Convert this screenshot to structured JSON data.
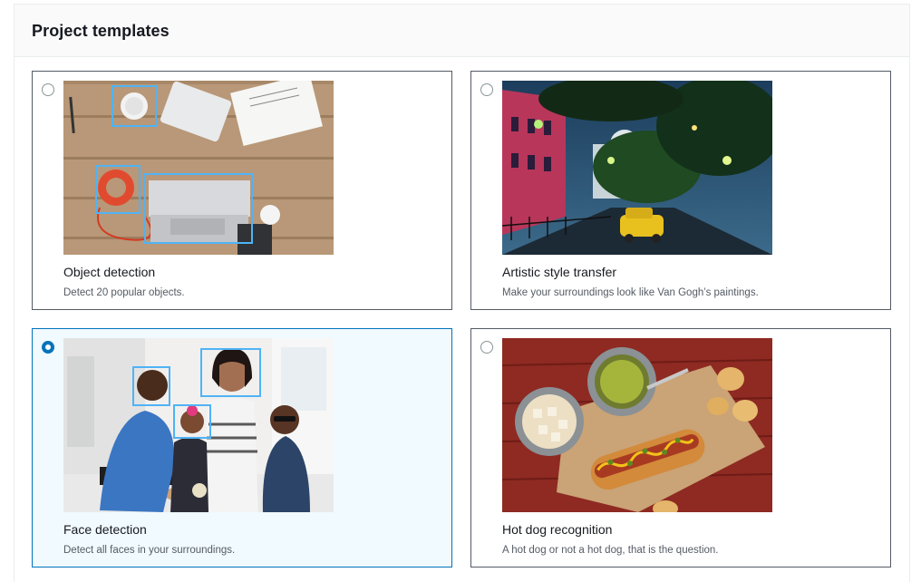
{
  "panel": {
    "title": "Project templates"
  },
  "templates": [
    {
      "title": "Object detection",
      "description": "Detect 20 popular objects.",
      "selected": false,
      "image": "desk-with-laptop-coffee-headphones-notebook"
    },
    {
      "title": "Artistic style transfer",
      "description": "Make your surroundings look like Van Gogh’s paintings.",
      "selected": false,
      "image": "painted-night-street-with-taxi"
    },
    {
      "title": "Face detection",
      "description": "Detect all faces in your surroundings.",
      "selected": true,
      "image": "family-cooking-in-kitchen"
    },
    {
      "title": "Hot dog recognition",
      "description": "A hot dog or not a hot dog, that is the question.",
      "selected": false,
      "image": "hot-dog-with-relish-onions-chips"
    }
  ],
  "colors": {
    "selected_border": "#0073bb",
    "selected_background": "#f1faff",
    "card_border": "#545b64",
    "bounding_box": "#4fb3f6"
  }
}
